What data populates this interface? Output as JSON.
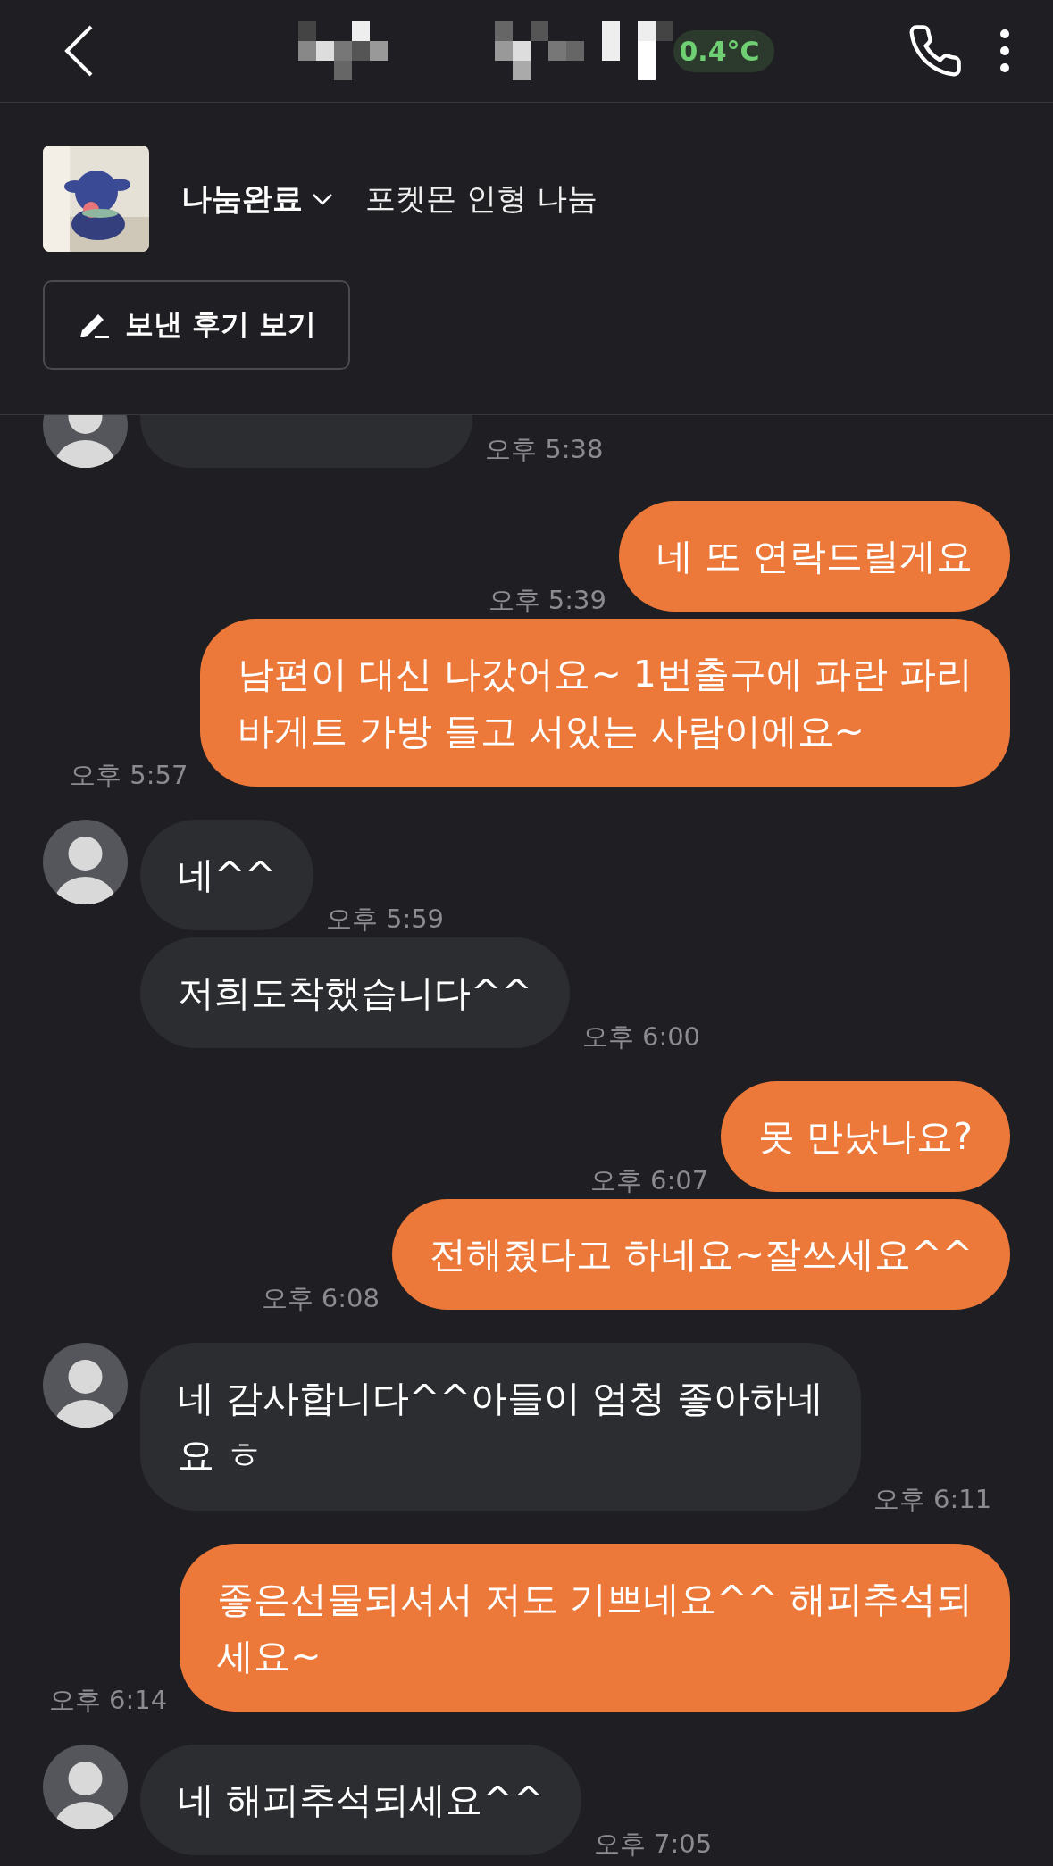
{
  "header": {
    "temperature": "0.4°C"
  },
  "product": {
    "status": "나눔완료",
    "title": "포켓몬 인형 나눔",
    "review_button": "보낸 후기 보기"
  },
  "messages": [
    {
      "kind": "incoming",
      "avatar": true,
      "clipped": true,
      "time": "오후 5:38"
    },
    {
      "kind": "outgoing",
      "lines": [
        "네 또 연락드릴게요"
      ],
      "time": "오후 5:39"
    },
    {
      "kind": "outgoing",
      "lines": [
        "남편이 대신 나갔어요~ 1번출구에 파란 파리",
        "바게트 가방 들고 서있는 사람이에요~"
      ],
      "time": "오후 5:57"
    },
    {
      "kind": "incoming",
      "avatar": true,
      "lines": [
        "네^^"
      ],
      "time": "오후 5:59"
    },
    {
      "kind": "incoming",
      "avatar": false,
      "lines": [
        "저희도착했습니다^^"
      ],
      "time": "오후 6:00"
    },
    {
      "kind": "outgoing",
      "lines": [
        "못 만났나요?"
      ],
      "time": "오후 6:07"
    },
    {
      "kind": "outgoing",
      "lines": [
        "전해줬다고 하네요~잘쓰세요^^"
      ],
      "time": "오후 6:08"
    },
    {
      "kind": "incoming",
      "avatar": true,
      "lines": [
        "네 감사합니다^^아들이 엄청 좋아하네",
        "요 ㅎ"
      ],
      "time": "오후 6:11"
    },
    {
      "kind": "outgoing",
      "lines": [
        "좋은선물되셔서 저도 기쁘네요^^ 해피추석되",
        "세요~"
      ],
      "time": "오후 6:14"
    },
    {
      "kind": "incoming",
      "avatar": true,
      "lines": [
        "네 해피추석되세요^^"
      ],
      "time": "오후 7:05"
    }
  ]
}
